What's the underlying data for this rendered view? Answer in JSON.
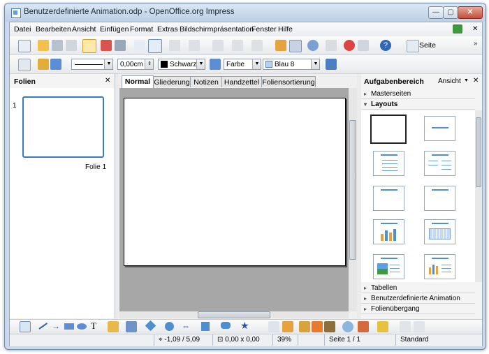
{
  "window": {
    "title": "Benutzerdefinierte Animation.odp - OpenOffice.org Impress",
    "minimize": "—",
    "maximize": "▢",
    "close": "✕"
  },
  "menu": [
    "Datei",
    "Bearbeiten",
    "Ansicht",
    "Einfügen",
    "Format",
    "Extras",
    "Bildschirmpräsentation",
    "Fenster",
    "Hilfe"
  ],
  "toolbar": {
    "slide_label": "Seite",
    "line_width": "0,00cm",
    "line_color": "Schwarz",
    "area_style": "Farbe",
    "area_color": "Blau 8"
  },
  "slides_panel": {
    "title": "Folien",
    "close": "✕",
    "slide_number": "1",
    "slide_name": "Folie 1"
  },
  "view_tabs": [
    "Normal",
    "Gliederung",
    "Notizen",
    "Handzettel",
    "Foliensortierung"
  ],
  "task_pane": {
    "title": "Aufgabenbereich",
    "view_menu": "Ansicht",
    "close": "✕",
    "sections_top": [
      "Masterseiten",
      "Layouts"
    ],
    "sections_bottom": [
      "Tabellen",
      "Benutzerdefinierte Animation",
      "Folienübergang"
    ]
  },
  "status": {
    "position": "-1,09 / 5,09",
    "size": "0,00 x 0,00",
    "zoom": "39%",
    "slide": "Seite 1 / 1",
    "master": "Standard"
  },
  "colors": {
    "accent": "#4f8fd0",
    "black_swatch": "#000000",
    "blue8_swatch": "#b4d3f0",
    "canvas_bg": "#a7a7a7",
    "selection": "#3a78c8"
  }
}
